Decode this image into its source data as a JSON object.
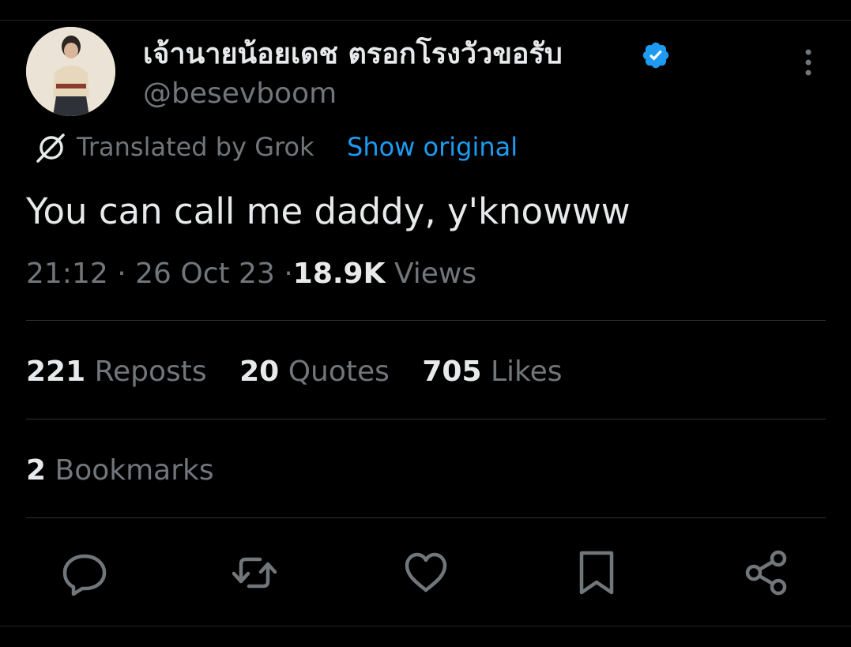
{
  "author": {
    "display_name": "เจ้านายน้อยเดช ตรอกโรงวัวขอรับ",
    "handle": "@besevboom",
    "verified": true
  },
  "translation": {
    "label": "Translated by Grok",
    "show_original": "Show original"
  },
  "tweet": {
    "text": "You can call me daddy, y'knowww",
    "time": "21:12",
    "date": "26 Oct 23",
    "separator": "·",
    "views_count": "18.9K",
    "views_label": "Views"
  },
  "stats": {
    "reposts_count": "221",
    "reposts_label": "Reposts",
    "quotes_count": "20",
    "quotes_label": "Quotes",
    "likes_count": "705",
    "likes_label": "Likes",
    "bookmarks_count": "2",
    "bookmarks_label": "Bookmarks"
  },
  "icons": {
    "verified": "verified-badge-icon",
    "more": "more-vertical-icon",
    "grok": "grok-icon",
    "reply": "reply-icon",
    "repost": "repost-icon",
    "like": "heart-icon",
    "bookmark": "bookmark-icon",
    "share": "share-icon"
  },
  "colors": {
    "background": "#000000",
    "text_primary": "#e7e9ea",
    "text_secondary": "#71767b",
    "accent": "#1d9bf0",
    "divider": "#2f3336"
  }
}
